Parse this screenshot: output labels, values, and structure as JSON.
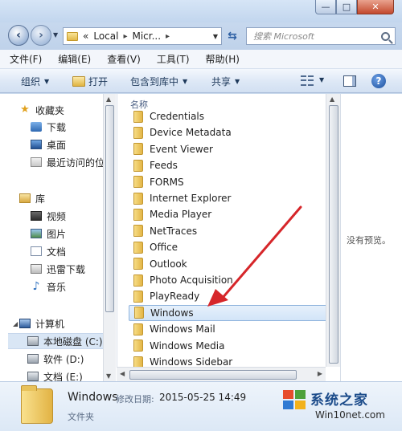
{
  "window": {
    "minimize": "—",
    "maximize": "□",
    "close": "✕"
  },
  "address": {
    "chevrons": "«",
    "seg1": "Local",
    "seg2": "Micr...",
    "sep": "▸",
    "search_placeholder": "搜索 Microsoft"
  },
  "menu": [
    "文件(F)",
    "编辑(E)",
    "查看(V)",
    "工具(T)",
    "帮助(H)"
  ],
  "toolbar": {
    "organize": "组织",
    "open": "打开",
    "include": "包含到库中",
    "share": "共享"
  },
  "nav": {
    "favorites": "收藏夹",
    "downloads": "下载",
    "desktop": "桌面",
    "recent": "最近访问的位",
    "libraries": "库",
    "video": "视频",
    "pictures": "图片",
    "documents": "文档",
    "xunlei": "迅雷下载",
    "music": "音乐",
    "computer": "计算机",
    "drive_c": "本地磁盘 (C:)",
    "drive_d": "软件 (D:)",
    "drive_e": "文档 (E:)"
  },
  "files": {
    "column_name": "名称",
    "items": [
      "Credentials",
      "Device Metadata",
      "Event Viewer",
      "Feeds",
      "FORMS",
      "Internet Explorer",
      "Media Player",
      "NetTraces",
      "Office",
      "Outlook",
      "Photo Acquisition",
      "PlayReady",
      "Windows",
      "Windows Mail",
      "Windows Media",
      "Windows Sidebar"
    ],
    "selected_index": 12
  },
  "preview": {
    "message": "没有预览。"
  },
  "details": {
    "name": "Windows",
    "date_label": "修改日期:",
    "date_value": "2015-05-25 14:49",
    "type": "文件夹"
  },
  "watermark": {
    "title": "系统之家",
    "url": "Win10net.com"
  },
  "colors": {
    "selection": "#d2e4f8",
    "arrow": "#d6262a",
    "chrome": "#c9d9ec"
  }
}
